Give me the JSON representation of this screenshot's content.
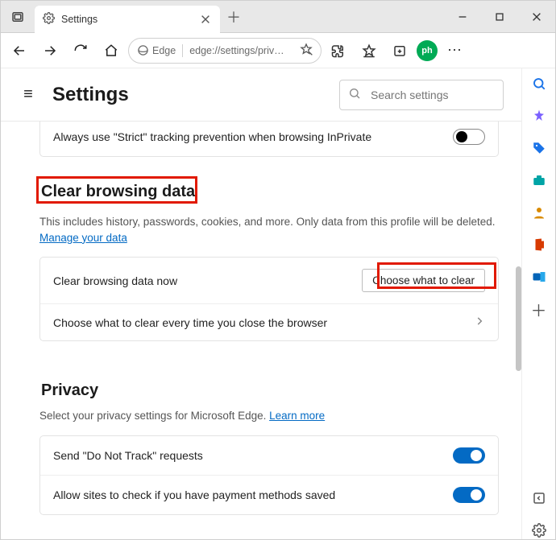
{
  "titlebar": {
    "tab_title": "Settings",
    "close_glyph": "×",
    "newtab_glyph": "＋"
  },
  "toolbar": {
    "edge_label": "Edge",
    "url": "edge://settings/priv…",
    "avatar": "ph",
    "more_glyph": "⋯"
  },
  "header": {
    "menu_glyph": "≡",
    "title": "Settings",
    "search_placeholder": "Search settings"
  },
  "sections": {
    "tracking_row": "Always use \"Strict\" tracking prevention when browsing InPrivate",
    "clear_title": "Clear browsing data",
    "clear_desc": "This includes history, passwords, cookies, and more. Only data from this profile will be deleted. ",
    "manage_link": "Manage your data",
    "clear_now_label": "Clear browsing data now",
    "choose_btn": "Choose what to clear",
    "choose_every_label": "Choose what to clear every time you close the browser",
    "privacy_title": "Privacy",
    "privacy_desc": "Select your privacy settings for Microsoft Edge. ",
    "learn_link": "Learn more",
    "dnt_label": "Send \"Do Not Track\" requests",
    "payment_label": "Allow sites to check if you have payment methods saved"
  },
  "rail": {
    "search_color": "#1a73e8",
    "tag_color": "#1a73e8",
    "briefcase_color": "#00a4a6",
    "person_color": "#d98a00",
    "office_color": "#d83b01",
    "outlook_color": "#0364b8"
  }
}
